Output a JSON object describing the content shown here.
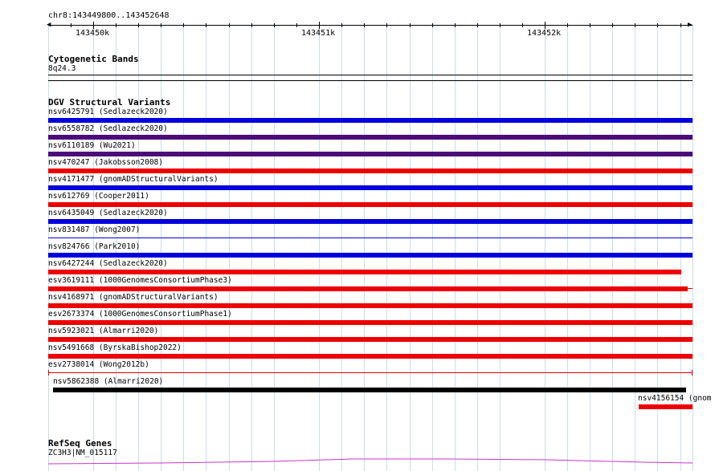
{
  "coordinates": "chr8:143449800..143452648",
  "ruler": {
    "ticks": [
      "143450k",
      "143451k",
      "143452k"
    ]
  },
  "cytobands": {
    "title": "Cytogenetic Bands",
    "band": "8q24.3"
  },
  "dgv": {
    "title": "DGV Structural Variants",
    "variants": [
      {
        "label": "nsv6425791 (Sedlazeck2020)",
        "color": "#0000dd",
        "thickness": "thick"
      },
      {
        "label": "nsv6558782 (Sedlazeck2020)",
        "color": "#4b0b7a",
        "thickness": "thick"
      },
      {
        "label": "nsv6110189 (Wu2021)",
        "color": "#4b0b7a",
        "thickness": "thick"
      },
      {
        "label": "nsv470247 (Jakobsson2008)",
        "color": "#ee0000",
        "thickness": "thick"
      },
      {
        "label": "nsv4171477 (gnomADStructuralVariants)",
        "color": "#0000dd",
        "thickness": "thick"
      },
      {
        "label": "nsv612769 (Cooper2011)",
        "color": "#ee0000",
        "thickness": "thick"
      },
      {
        "label": "nsv6435049 (Sedlazeck2020)",
        "color": "#0000dd",
        "thickness": "thick"
      },
      {
        "label": "nsv831487 (Wong2007)",
        "color": "#0000dd",
        "thickness": "thin"
      },
      {
        "label": "nsv824766 (Park2010)",
        "color": "#0000dd",
        "thickness": "thick"
      },
      {
        "label": "nsv6427244 (Sedlazeck2020)",
        "color": "#ee0000",
        "thickness": "thick"
      },
      {
        "label": "esv3619111 (1000GenomesConsortiumPhase3)",
        "color": "#ee0000",
        "thickness": "thick"
      },
      {
        "label": "nsv4168971 (gnomADStructuralVariants)",
        "color": "#ee0000",
        "thickness": "thick"
      },
      {
        "label": "esv2673374 (1000GenomesConsortiumPhase1)",
        "color": "#ee0000",
        "thickness": "thick"
      },
      {
        "label": "nsv5923021 (Almarri2020)",
        "color": "#ee0000",
        "thickness": "thick"
      },
      {
        "label": "nsv5491668 (ByrskaBishop2022)",
        "color": "#ee0000",
        "thickness": "thick"
      },
      {
        "label": "esv2738014 (Wong2012b)",
        "color": "#ee0000",
        "thickness": "thin"
      },
      {
        "label": "nsv5862388 (Almarri2020)",
        "color": "#000000",
        "thickness": "thick"
      },
      {
        "label": "nsv4156154 (gnom",
        "color": "#ee0000",
        "thickness": "thick"
      }
    ]
  },
  "refseq": {
    "title": "RefSeq Genes",
    "gene": "ZC3H3|NM_015117",
    "color": "#cc33cc"
  }
}
